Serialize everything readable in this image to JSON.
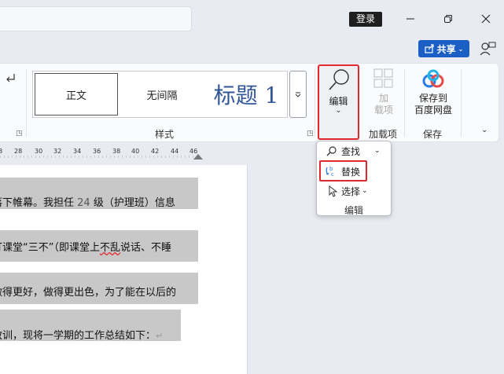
{
  "titlebar": {
    "login_label": "登录"
  },
  "share": {
    "label": "共享"
  },
  "styles": {
    "items": [
      "正文",
      "无间隔",
      "标题 1"
    ],
    "group_label": "样式"
  },
  "editing": {
    "button_label": "编辑"
  },
  "addins": {
    "button_label_line1": "加",
    "button_label_line2": "载项",
    "group_label": "加载项"
  },
  "baidu": {
    "button_label_line1": "保存到",
    "button_label_line2": "百度网盘",
    "group_label": "保存"
  },
  "ruler": {
    "ticks": [
      "8",
      "28",
      "30",
      "32",
      "34",
      "36",
      "38",
      "40",
      "42",
      "44",
      "46"
    ]
  },
  "document": {
    "line1_a": "落下帷幕。我担任 ",
    "line1_num": "24",
    "line1_b": " 级（护理班）信息",
    "line2_a": "订课堂“三不”（即课堂上",
    "line2_wavy": "不乱",
    "line2_b": "说话、不睡",
    "line3": "做得更好，做得更出色，为了能在以后的",
    "line4": "教训，现将一学期的工作总结如下：",
    "para_mark": "↵"
  },
  "edit_menu": {
    "find_label": "查找",
    "replace_label": "替换",
    "select_label": "选择",
    "group_label": "编辑"
  },
  "colors": {
    "accent_blue": "#1b5fc5",
    "highlight_red": "#e0292f",
    "heading_blue": "#2f5597"
  }
}
